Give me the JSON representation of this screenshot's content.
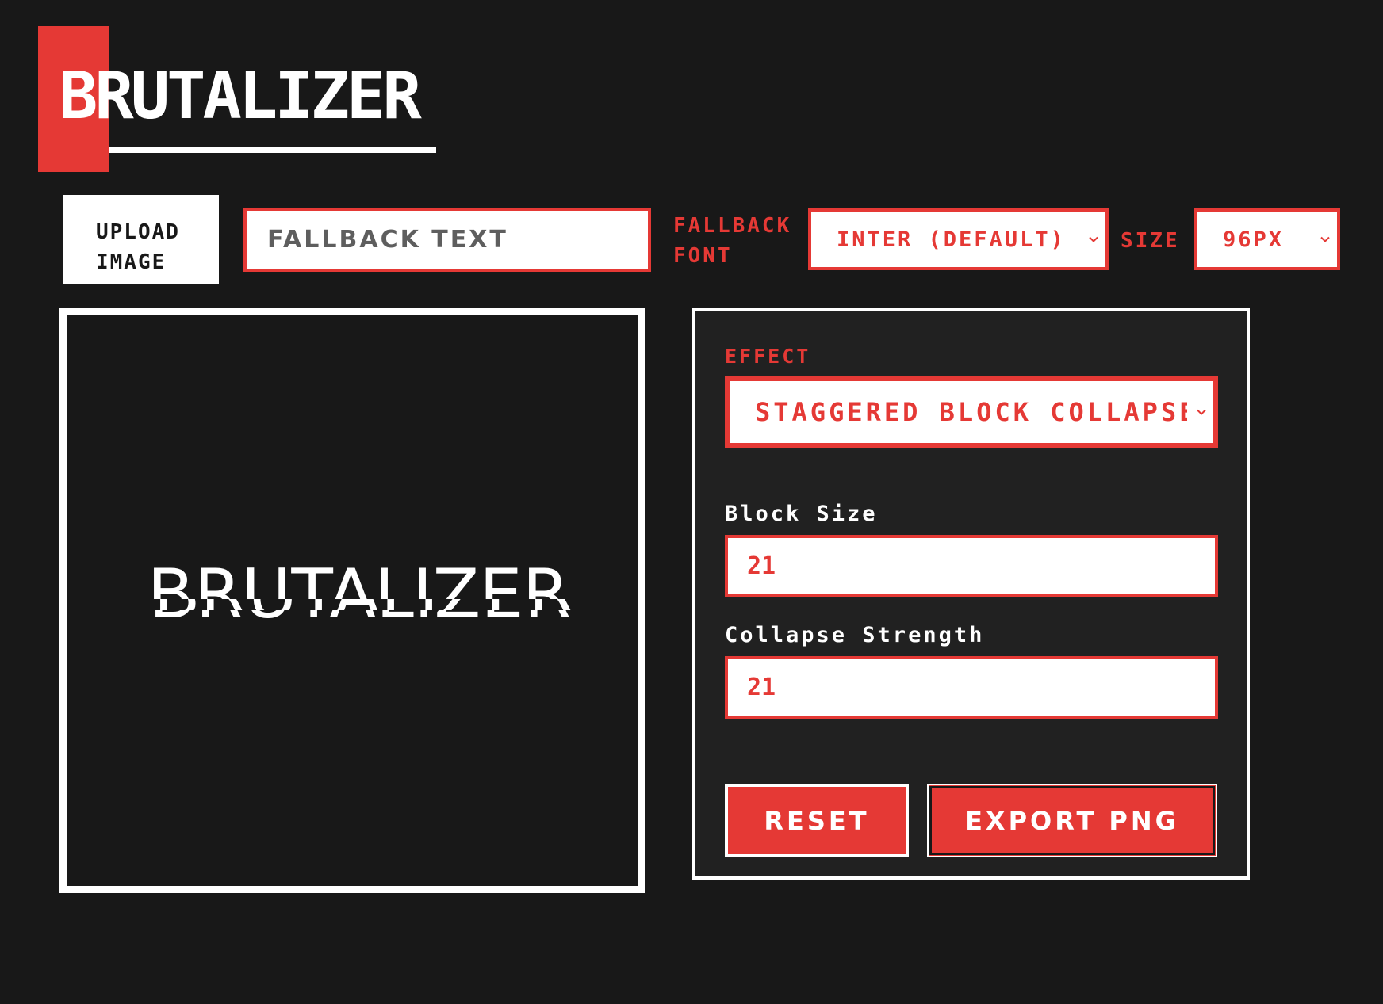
{
  "app": {
    "title": "BRUTALIZER"
  },
  "toolbar": {
    "upload_label_line1": "UPLOAD",
    "upload_label_line2": "IMAGE",
    "fallback_text_placeholder": "FALLBACK TEXT",
    "fallback_text_value": "",
    "fallback_font_label_line1": "FALLBACK",
    "fallback_font_label_line2": "FONT",
    "fallback_font_selected": "INTER (DEFAULT)",
    "size_label": "SIZE",
    "size_selected": "96PX"
  },
  "preview": {
    "rendered_text": "BRUTALIZER"
  },
  "controls": {
    "effect_label": "EFFECT",
    "effect_selected": "STAGGERED BLOCK COLLAPSE",
    "block_size_label": "Block Size",
    "block_size_value": "21",
    "collapse_strength_label": "Collapse Strength",
    "collapse_strength_value": "21",
    "reset_label": "RESET",
    "export_label": "EXPORT PNG"
  },
  "icons": {
    "select_chevron": "chevron-down-icon"
  },
  "colors": {
    "background": "#181818",
    "panel": "#212121",
    "accent": "#e53935",
    "white": "#ffffff"
  }
}
